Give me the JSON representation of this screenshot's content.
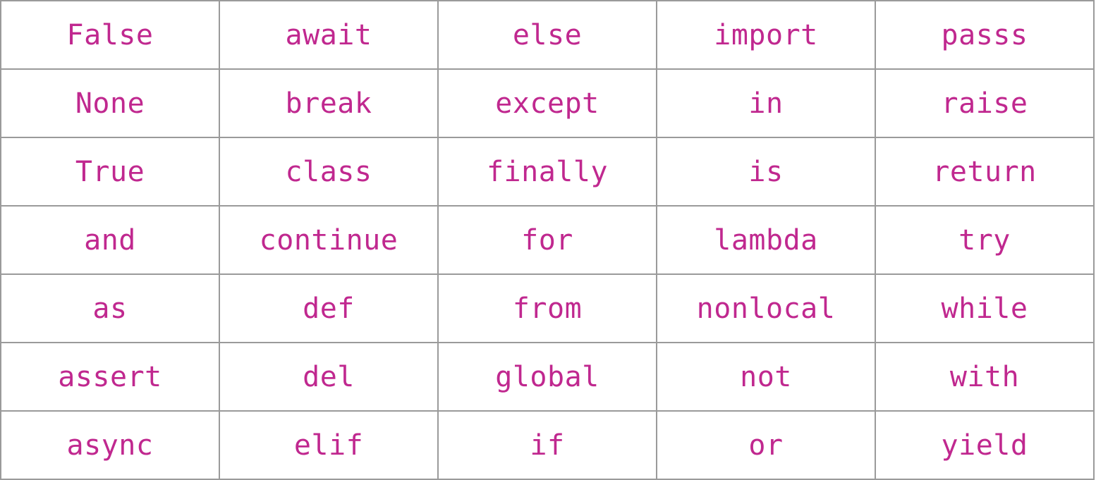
{
  "keywords_table": {
    "rows": [
      [
        "False",
        "await",
        "else",
        "import",
        "passs"
      ],
      [
        "None",
        "break",
        "except",
        "in",
        "raise"
      ],
      [
        "True",
        "class",
        "finally",
        "is",
        "return"
      ],
      [
        "and",
        "continue",
        "for",
        "lambda",
        "try"
      ],
      [
        "as",
        "def",
        "from",
        "nonlocal",
        "while"
      ],
      [
        "assert",
        "del",
        "global",
        "not",
        "with"
      ],
      [
        "async",
        "elif",
        "if",
        "or",
        "yield"
      ]
    ]
  },
  "colors": {
    "text": "#c0288f",
    "border": "#9a9a9a",
    "background": "#ffffff"
  }
}
